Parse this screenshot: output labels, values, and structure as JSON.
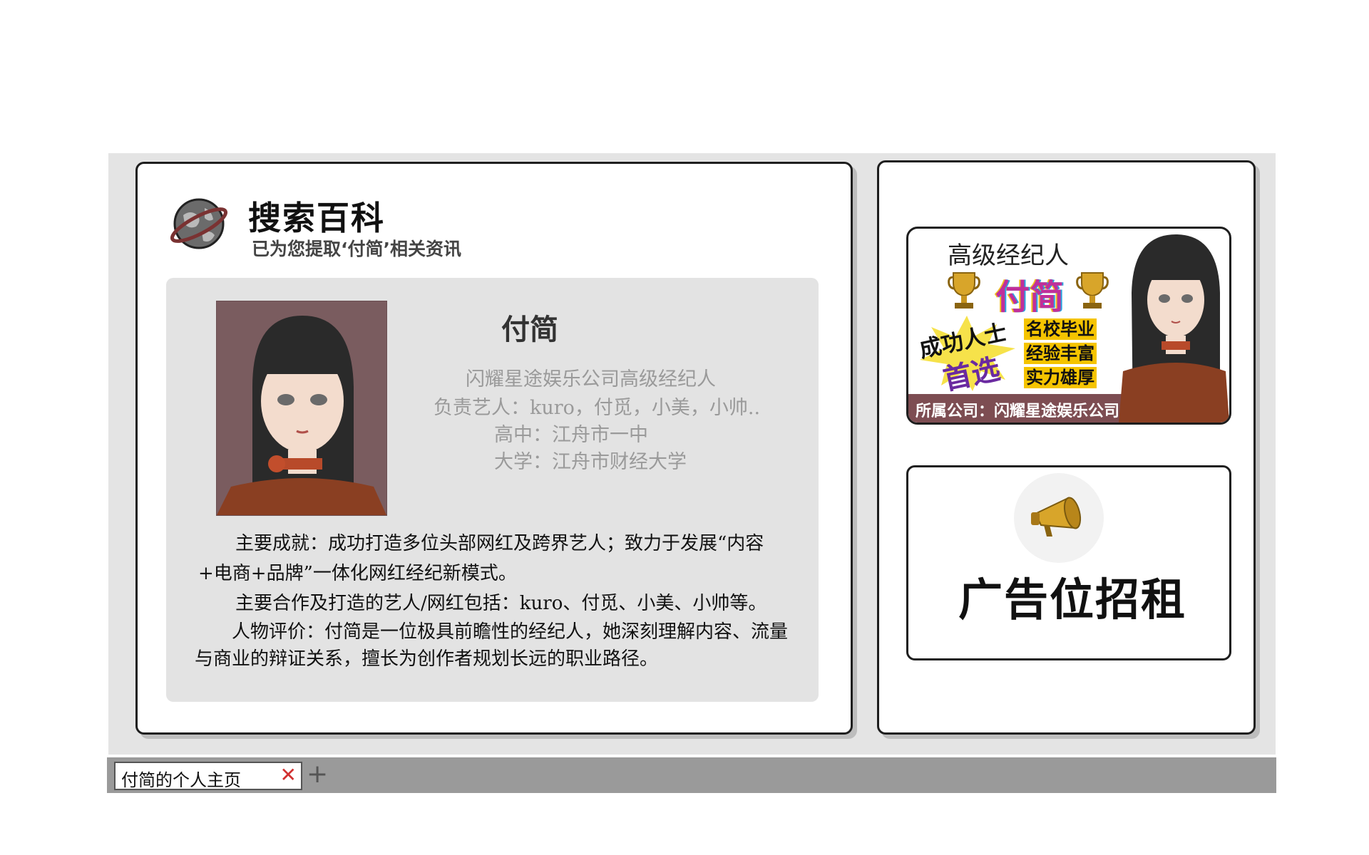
{
  "search": {
    "title": "搜索百科",
    "subtitle": "已为您提取‘付简’相关资讯"
  },
  "profile": {
    "name": "付简",
    "details": [
      "闪耀星途娱乐公司高级经纪人",
      "负责艺人：kuro，付觅，小美，小帅..",
      "高中：江舟市一中",
      "大学：江舟市财经大学"
    ],
    "paragraphs": [
      "主要成就：成功打造多位头部网红及跨界艺人；致力于发展“内容+电商+品牌”一体化网红经纪新模式。",
      "主要合作及打造的艺人/网红包括：kuro、付觅、小美、小帅等。",
      "人物评价：付简是一位极具前瞻性的经纪人，她深刻理解内容、流量与商业的辩证关系，擅长为创作者规划长远的职业路径。"
    ]
  },
  "agent_card": {
    "role": "高级经纪人",
    "name": "付简",
    "burst_line1": "成功人士",
    "burst_line2": "首选",
    "badges": [
      "名校毕业",
      "经验丰富",
      "实力雄厚"
    ],
    "company": "所属公司：闪耀星途娱乐公司"
  },
  "ad": {
    "text": "广告位招租"
  },
  "tabbar": {
    "tab_label": "付简的个人主页",
    "close_glyph": "✕",
    "add_glyph": "+"
  },
  "colors": {
    "badge": "#f5c400",
    "company_bar": "#7d4d52",
    "portrait_bg": "#7a5c5f",
    "panel": "#e3e3e3"
  },
  "icons": [
    "globe-icon",
    "trophy-icon",
    "megaphone-icon",
    "close-icon",
    "plus-icon"
  ]
}
